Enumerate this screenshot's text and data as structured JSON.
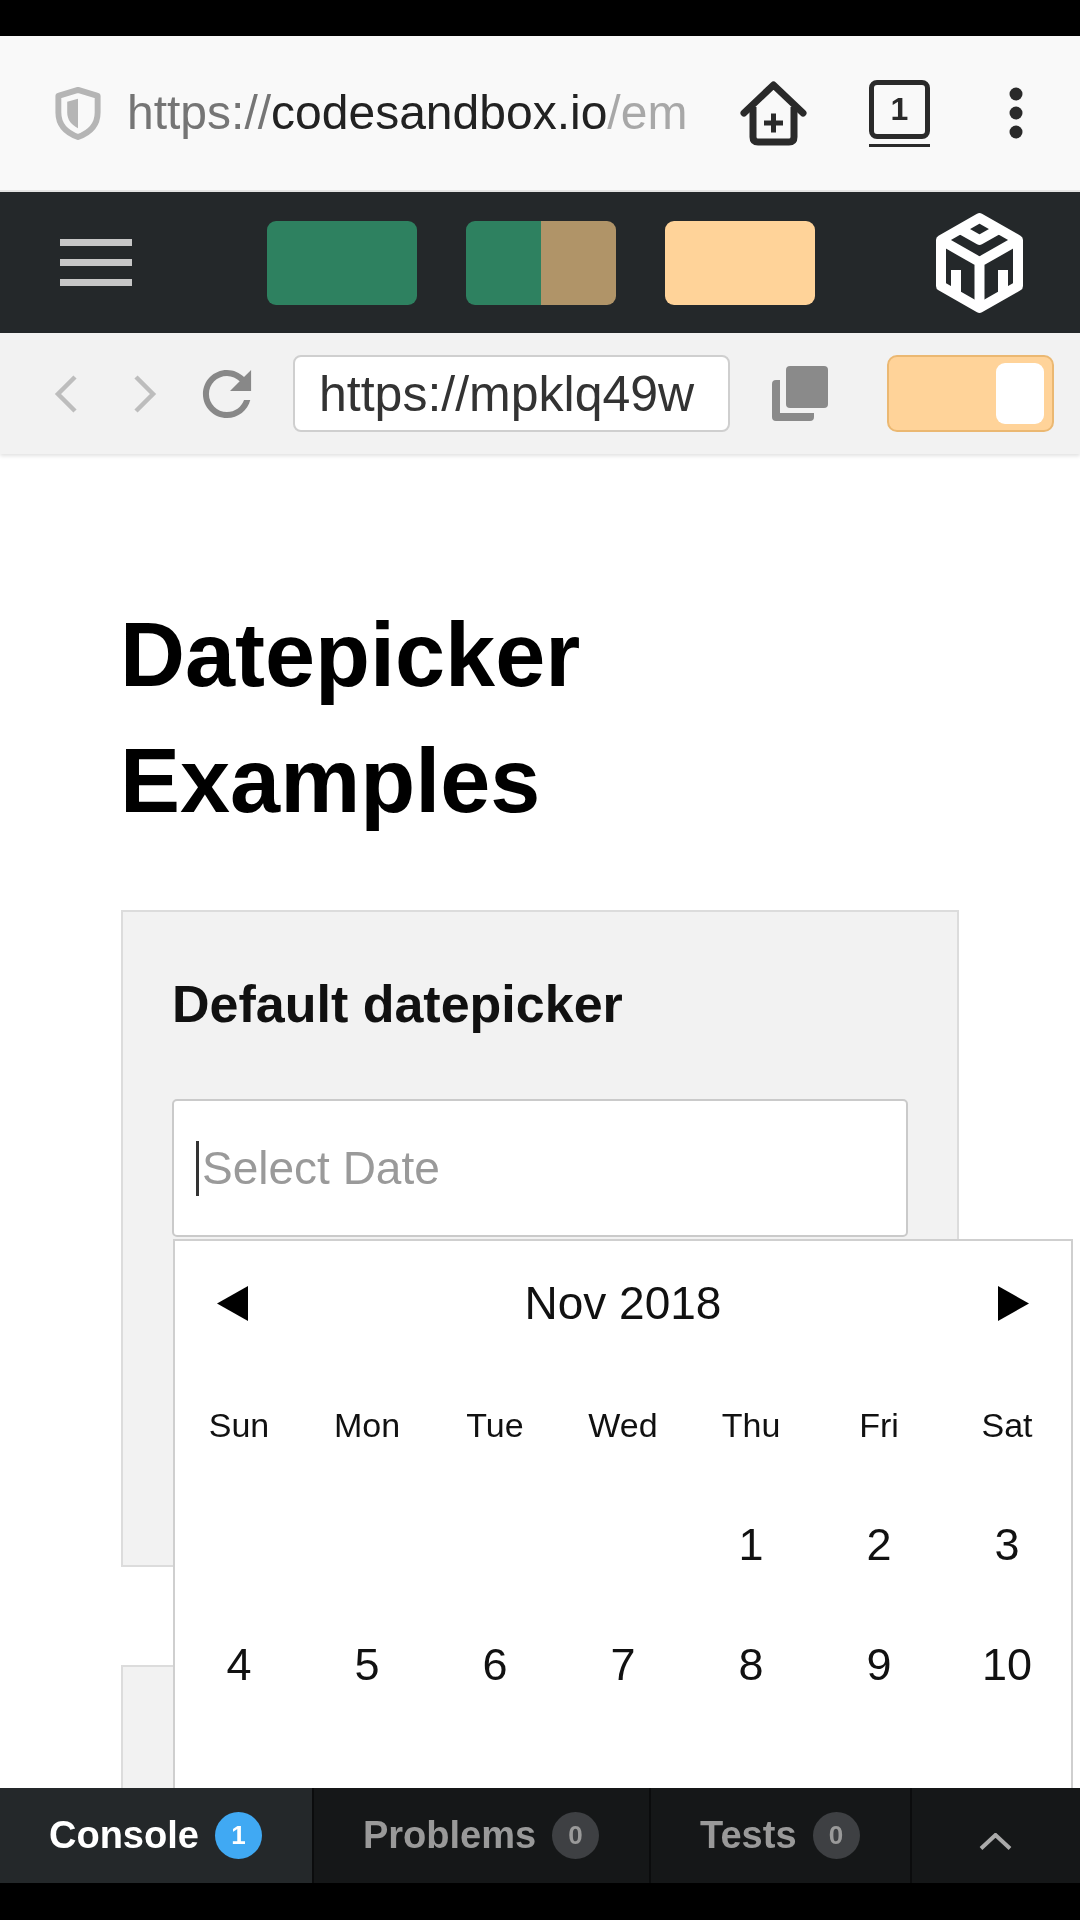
{
  "browser": {
    "address": {
      "scheme": "https://",
      "host": "codesandbox.io",
      "path": "/em"
    },
    "tab_count": "1"
  },
  "preview_toolbar": {
    "url": "https://mpklq49w",
    "toggle": {
      "on": true
    }
  },
  "page": {
    "title": "Datepicker Examples",
    "cards": [
      {
        "heading": "Default datepicker",
        "input": {
          "placeholder": "Select Date",
          "focused": true
        },
        "calendar": {
          "month": "Nov 2018",
          "weekdays": [
            "Sun",
            "Mon",
            "Tue",
            "Wed",
            "Thu",
            "Fri",
            "Sat"
          ],
          "weeks": [
            [
              "1",
              "2",
              "3"
            ],
            [
              "4",
              "5",
              "6",
              "7",
              "8",
              "9",
              "10"
            ]
          ]
        }
      }
    ]
  },
  "panel_tabs": [
    {
      "label": "Console",
      "count": "1",
      "selected": true,
      "color": "#40a9f3"
    },
    {
      "label": "Problems",
      "count": "0",
      "selected": false,
      "color": "#3e4043"
    },
    {
      "label": "Tests",
      "count": "0",
      "selected": false,
      "color": "#3e4043"
    }
  ]
}
